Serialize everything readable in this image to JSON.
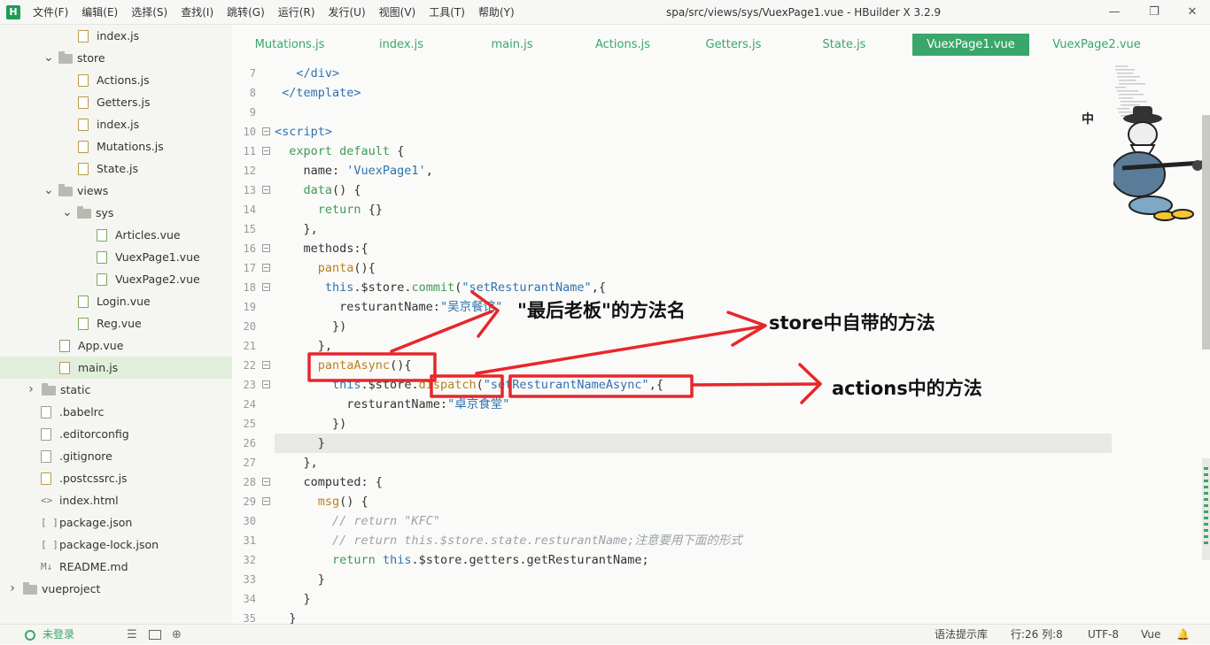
{
  "app": {
    "logo": "H",
    "window_title": "spa/src/views/sys/VuexPage1.vue - HBuilder X 3.2.9",
    "menu": [
      "文件(F)",
      "编辑(E)",
      "选择(S)",
      "查找(I)",
      "跳转(G)",
      "运行(R)",
      "发行(U)",
      "视图(V)",
      "工具(T)",
      "帮助(Y)"
    ],
    "window_controls": {
      "minimize": "—",
      "maximize": "❐",
      "close": "✕"
    }
  },
  "tree": [
    {
      "label": "index.js",
      "kind": "file-js"
    },
    {
      "label": "store",
      "kind": "folder-open"
    },
    {
      "label": "Actions.js",
      "kind": "file-js"
    },
    {
      "label": "Getters.js",
      "kind": "file-js"
    },
    {
      "label": "index.js",
      "kind": "file-js"
    },
    {
      "label": "Mutations.js",
      "kind": "file-js"
    },
    {
      "label": "State.js",
      "kind": "file-js"
    },
    {
      "label": "views",
      "kind": "folder-open"
    },
    {
      "label": "sys",
      "kind": "folder-open"
    },
    {
      "label": "Articles.vue",
      "kind": "file-vue"
    },
    {
      "label": "VuexPage1.vue",
      "kind": "file-vue"
    },
    {
      "label": "VuexPage2.vue",
      "kind": "file-vue"
    },
    {
      "label": "Login.vue",
      "kind": "file-vue"
    },
    {
      "label": "Reg.vue",
      "kind": "file-vue"
    },
    {
      "label": "App.vue",
      "kind": "file-vue"
    },
    {
      "label": "main.js",
      "kind": "file-js",
      "selected": true
    },
    {
      "label": "static",
      "kind": "folder-closed"
    },
    {
      "label": ".babelrc",
      "kind": "file"
    },
    {
      "label": ".editorconfig",
      "kind": "file"
    },
    {
      "label": ".gitignore",
      "kind": "file"
    },
    {
      "label": ".postcssrc.js",
      "kind": "file-js"
    },
    {
      "label": "index.html",
      "kind": "html"
    },
    {
      "label": "package.json",
      "kind": "json"
    },
    {
      "label": "package-lock.json",
      "kind": "json"
    },
    {
      "label": "README.md",
      "kind": "md"
    },
    {
      "label": "vueproject",
      "kind": "folder-closed"
    }
  ],
  "tree_glyphs": {
    "html": "<>",
    "json": "[ ]",
    "md": "M↓"
  },
  "tabs": [
    {
      "label": "Mutations.js"
    },
    {
      "label": "index.js"
    },
    {
      "label": "main.js"
    },
    {
      "label": "Actions.js"
    },
    {
      "label": "Getters.js"
    },
    {
      "label": "State.js"
    },
    {
      "label": "VuexPage1.vue",
      "active": true
    },
    {
      "label": "VuexPage2.vue"
    }
  ],
  "editor": {
    "current_line": 26,
    "lines": [
      {
        "n": "7",
        "fold": "",
        "segs": [
          [
            "   ",
            ""
          ],
          [
            "</div>",
            "tag"
          ]
        ]
      },
      {
        "n": "8",
        "fold": "",
        "segs": [
          [
            " ",
            ""
          ],
          [
            "</template>",
            "tag"
          ]
        ]
      },
      {
        "n": "9",
        "fold": "",
        "segs": []
      },
      {
        "n": "10",
        "fold": "−",
        "segs": [
          [
            "<script>",
            "tag"
          ]
        ]
      },
      {
        "n": "11",
        "fold": "−",
        "segs": [
          [
            "  ",
            ""
          ],
          [
            "export default",
            "kw"
          ],
          [
            " {",
            ""
          ]
        ]
      },
      {
        "n": "12",
        "fold": "",
        "segs": [
          [
            "    name: ",
            ""
          ],
          [
            "'VuexPage1'",
            "str"
          ],
          [
            ",",
            ""
          ]
        ]
      },
      {
        "n": "13",
        "fold": "−",
        "segs": [
          [
            "    ",
            ""
          ],
          [
            "data",
            "kw"
          ],
          [
            "() {",
            ""
          ]
        ]
      },
      {
        "n": "14",
        "fold": "",
        "segs": [
          [
            "      ",
            ""
          ],
          [
            "return",
            "kw"
          ],
          [
            " {}",
            ""
          ]
        ]
      },
      {
        "n": "15",
        "fold": "",
        "segs": [
          [
            "    },",
            ""
          ]
        ]
      },
      {
        "n": "16",
        "fold": "−",
        "segs": [
          [
            "    methods:{",
            ""
          ]
        ]
      },
      {
        "n": "17",
        "fold": "−",
        "segs": [
          [
            "      ",
            ""
          ],
          [
            "panta",
            "fn"
          ],
          [
            "(){",
            ""
          ]
        ]
      },
      {
        "n": "18",
        "fold": "−",
        "segs": [
          [
            "       ",
            ""
          ],
          [
            "this",
            "str"
          ],
          [
            ".$store.",
            ""
          ],
          [
            "commit",
            "kw"
          ],
          [
            "(",
            ""
          ],
          [
            "\"setResturantName\"",
            "str"
          ],
          [
            ",{",
            ""
          ]
        ]
      },
      {
        "n": "19",
        "fold": "",
        "segs": [
          [
            "         resturantName:",
            ""
          ],
          [
            "\"吴京餐馆\"",
            "str"
          ]
        ]
      },
      {
        "n": "20",
        "fold": "",
        "segs": [
          [
            "        })",
            ""
          ]
        ]
      },
      {
        "n": "21",
        "fold": "",
        "segs": [
          [
            "      },",
            ""
          ]
        ]
      },
      {
        "n": "22",
        "fold": "−",
        "segs": [
          [
            "      ",
            ""
          ],
          [
            "pantaAsync",
            "fn"
          ],
          [
            "(){",
            ""
          ]
        ]
      },
      {
        "n": "23",
        "fold": "−",
        "segs": [
          [
            "        ",
            ""
          ],
          [
            "this",
            "str"
          ],
          [
            ".$store.",
            ""
          ],
          [
            "dispatch",
            "fn"
          ],
          [
            "(",
            ""
          ],
          [
            "\"setResturantNameAsync\"",
            "str"
          ],
          [
            ",{",
            ""
          ]
        ]
      },
      {
        "n": "24",
        "fold": "",
        "segs": [
          [
            "          resturantName:",
            ""
          ],
          [
            "\"卓京食堂\"",
            "str"
          ]
        ]
      },
      {
        "n": "25",
        "fold": "",
        "segs": [
          [
            "        })",
            ""
          ]
        ]
      },
      {
        "n": "26",
        "fold": "",
        "segs": [
          [
            "      }",
            ""
          ]
        ]
      },
      {
        "n": "27",
        "fold": "",
        "segs": [
          [
            "    },",
            ""
          ]
        ]
      },
      {
        "n": "28",
        "fold": "−",
        "segs": [
          [
            "    computed: {",
            ""
          ]
        ]
      },
      {
        "n": "29",
        "fold": "−",
        "segs": [
          [
            "      ",
            ""
          ],
          [
            "msg",
            "fn"
          ],
          [
            "() {",
            ""
          ]
        ]
      },
      {
        "n": "30",
        "fold": "",
        "segs": [
          [
            "        ",
            ""
          ],
          [
            "// return \"KFC\"",
            "cmt"
          ]
        ]
      },
      {
        "n": "31",
        "fold": "",
        "segs": [
          [
            "        ",
            ""
          ],
          [
            "// return this.$store.state.resturantName;注意要用下面的形式",
            "cmt"
          ]
        ]
      },
      {
        "n": "32",
        "fold": "",
        "segs": [
          [
            "        ",
            ""
          ],
          [
            "return",
            "kw"
          ],
          [
            " ",
            ""
          ],
          [
            "this",
            "str"
          ],
          [
            ".$store.getters.getResturantName;",
            ""
          ]
        ]
      },
      {
        "n": "33",
        "fold": "",
        "segs": [
          [
            "      }",
            ""
          ]
        ]
      },
      {
        "n": "34",
        "fold": "",
        "segs": [
          [
            "    }",
            ""
          ]
        ]
      },
      {
        "n": "35",
        "fold": "",
        "segs": [
          [
            "  }",
            ""
          ]
        ]
      }
    ]
  },
  "annotations": {
    "note1": "\"最后老板\"的方法名",
    "note2": "store中自带的方法",
    "note3": "actions中的方法",
    "color": "#e8262a"
  },
  "sticker_labels": [
    "中"
  ],
  "status": {
    "login": "未登录",
    "syntax_hint": "语法提示库",
    "position": "行:26  列:8",
    "encoding": "UTF-8",
    "language": "Vue"
  },
  "icons": [
    "user-icon",
    "list-icon",
    "terminal-icon",
    "globe-icon",
    "bell-icon",
    "folder-icon",
    "file-icon",
    "chevron-right-icon",
    "chevron-down-icon"
  ]
}
